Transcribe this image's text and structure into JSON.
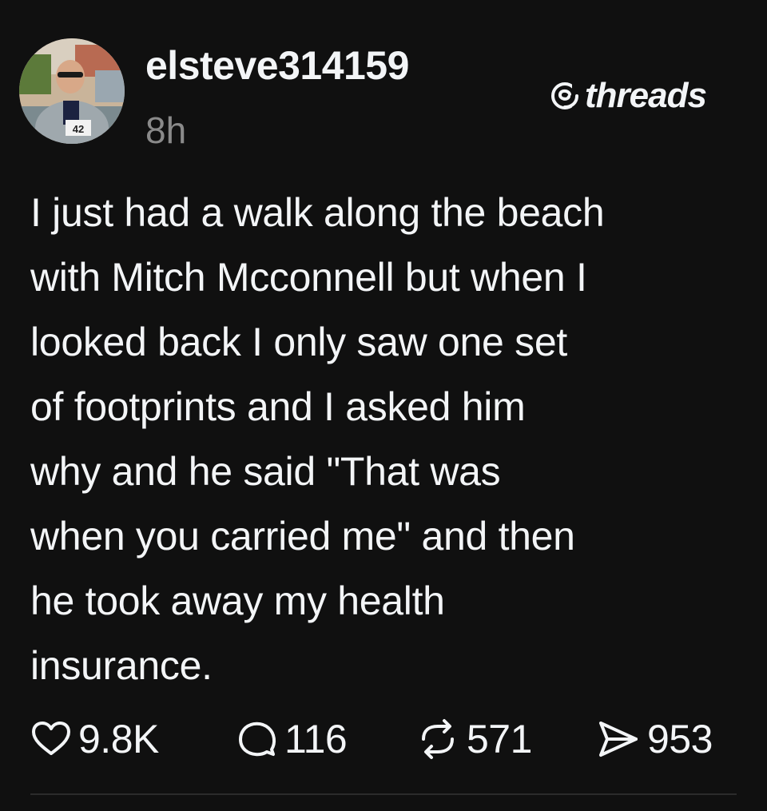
{
  "post": {
    "username": "elsteve314159",
    "timestamp": "8h",
    "brand": "threads",
    "body": "I just had a walk along the beach\nwith Mitch Mcconnell but when I\nlooked back I only saw one set\nof footprints and I asked him\nwhy and he said \"That was\nwhen you carried me\" and then\nhe took away my health\ninsurance.",
    "avatar_badge": "42"
  },
  "actions": {
    "likes": "9.8K",
    "replies": "116",
    "reposts": "571",
    "shares": "953"
  },
  "icons": {
    "like": "heart-icon",
    "reply": "speech-bubble-icon",
    "repost": "repost-arrows-icon",
    "share": "paper-plane-icon",
    "brand": "threads-logo-icon"
  },
  "colors": {
    "background": "#101010",
    "text": "#f3f5f7",
    "muted": "#8a8a8a"
  }
}
